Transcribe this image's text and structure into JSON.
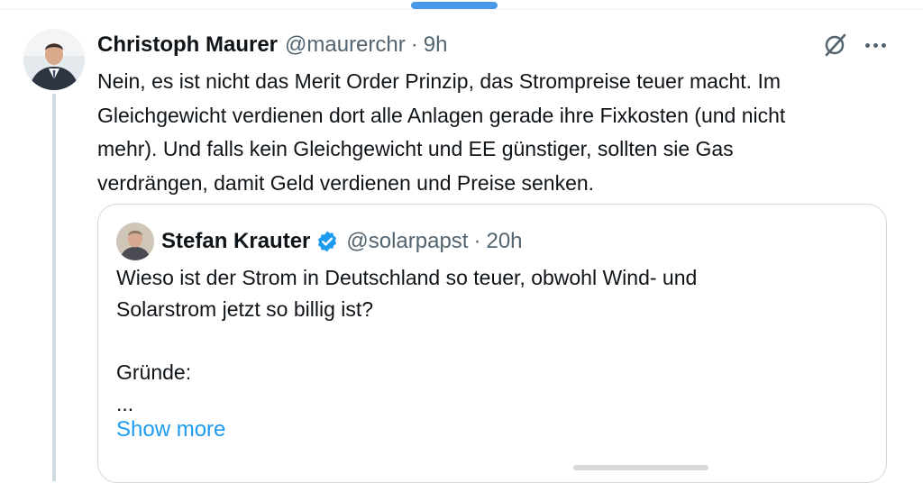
{
  "tweet": {
    "author_name": "Christoph Maurer",
    "handle": "@maurerchr",
    "separator": "·",
    "time": "9h",
    "text": "Nein, es ist nicht das Merit Order Prinzip, das Strompreise teuer macht. Im\nGleichgewicht verdienen dort alle Anlagen gerade ihre Fixkosten (und nicht\nmehr). Und falls kein Gleichgewicht und EE günstiger, sollten sie Gas\nverdrängen, damit Geld verdienen und Preise senken.",
    "icons": [
      "grok-icon",
      "more-options-icon"
    ]
  },
  "quote": {
    "author_name": "Stefan Krauter",
    "verified": true,
    "handle": "@solarpapst",
    "separator": "·",
    "time": "20h",
    "text": "Wieso ist der Strom in Deutschland so teuer, obwohl Wind- und\nSolarstrom jetzt so billig ist?\n\nGründe:\n...",
    "show_more_label": "Show more"
  },
  "colors": {
    "accent": "#1d9bf0",
    "text_primary": "#0f1419",
    "text_secondary": "#536471",
    "border": "#cfd9de",
    "top_indicator": "#4a99e9"
  }
}
